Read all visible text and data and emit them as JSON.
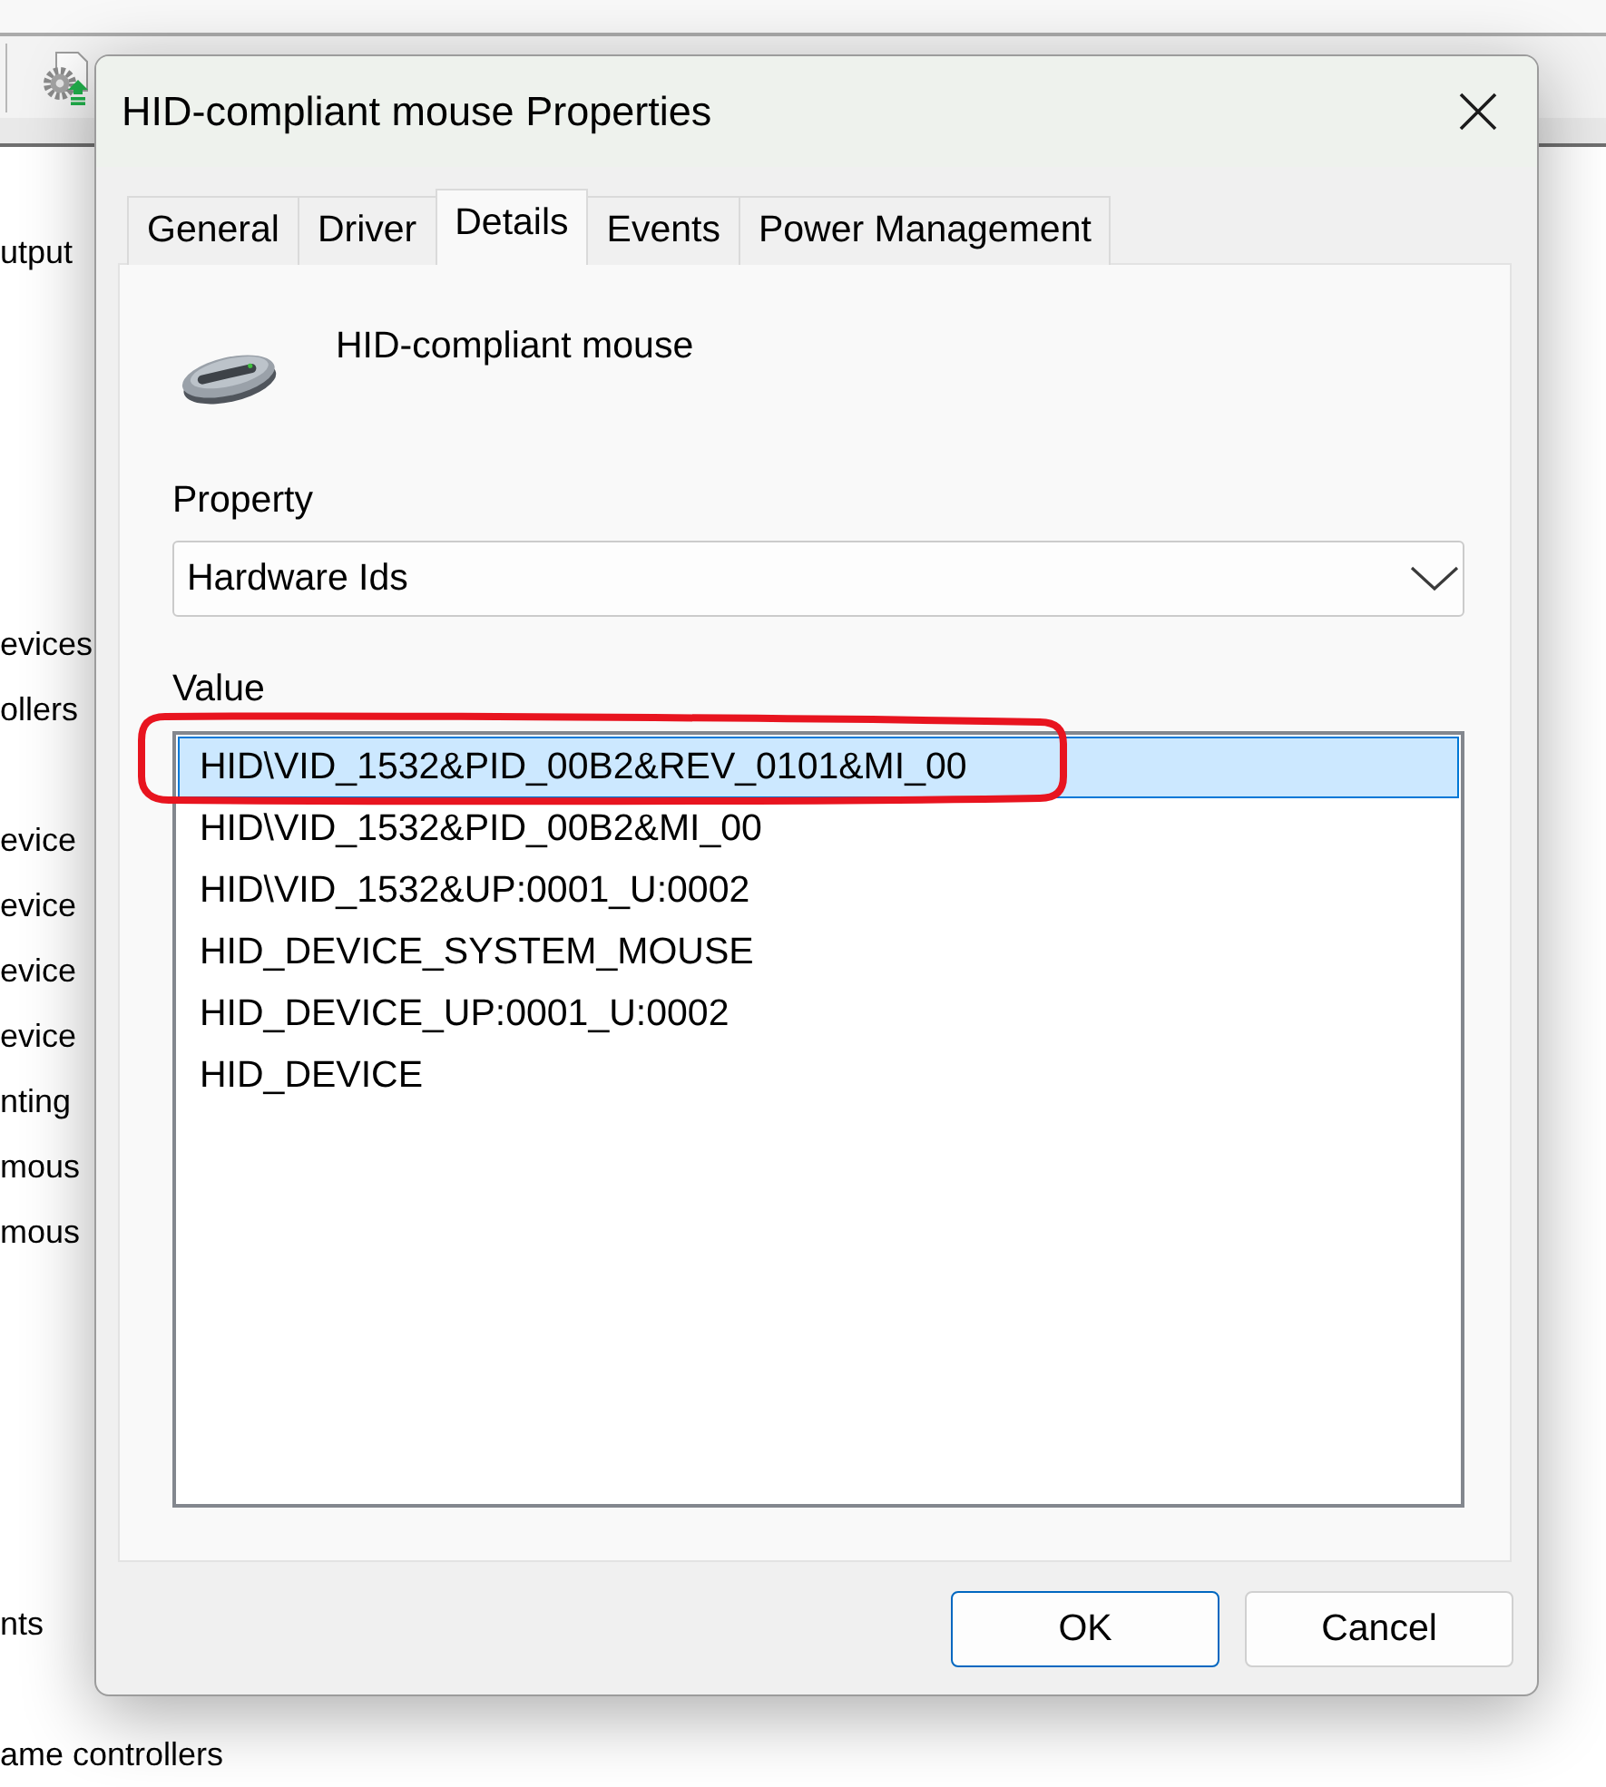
{
  "background_window": {
    "tree_groups": [
      [
        "utput"
      ],
      [
        "evices",
        "ollers"
      ],
      [
        "evice",
        "evice",
        "evice",
        "evice",
        "nting",
        "mous",
        "mous"
      ],
      [
        "nts"
      ],
      [
        "ame controllers"
      ]
    ]
  },
  "dialog": {
    "title": "HID-compliant mouse Properties",
    "tabs": [
      {
        "label": "General",
        "selected": false
      },
      {
        "label": "Driver",
        "selected": false
      },
      {
        "label": "Details",
        "selected": true
      },
      {
        "label": "Events",
        "selected": false
      },
      {
        "label": "Power Management",
        "selected": false
      }
    ],
    "device": {
      "name": "HID-compliant mouse"
    },
    "property": {
      "label": "Property",
      "value": "Hardware Ids"
    },
    "value": {
      "label": "Value",
      "items": [
        {
          "text": "HID\\VID_1532&PID_00B2&REV_0101&MI_00",
          "selected": true,
          "circled": true
        },
        {
          "text": "HID\\VID_1532&PID_00B2&MI_00",
          "selected": false,
          "circled": false
        },
        {
          "text": "HID\\VID_1532&UP:0001_U:0002",
          "selected": false,
          "circled": false
        },
        {
          "text": "HID_DEVICE_SYSTEM_MOUSE",
          "selected": false,
          "circled": false
        },
        {
          "text": "HID_DEVICE_UP:0001_U:0002",
          "selected": false,
          "circled": false
        },
        {
          "text": "HID_DEVICE",
          "selected": false,
          "circled": false
        }
      ]
    },
    "buttons": [
      {
        "label": "OK",
        "default": true
      },
      {
        "label": "Cancel",
        "default": false
      }
    ]
  }
}
